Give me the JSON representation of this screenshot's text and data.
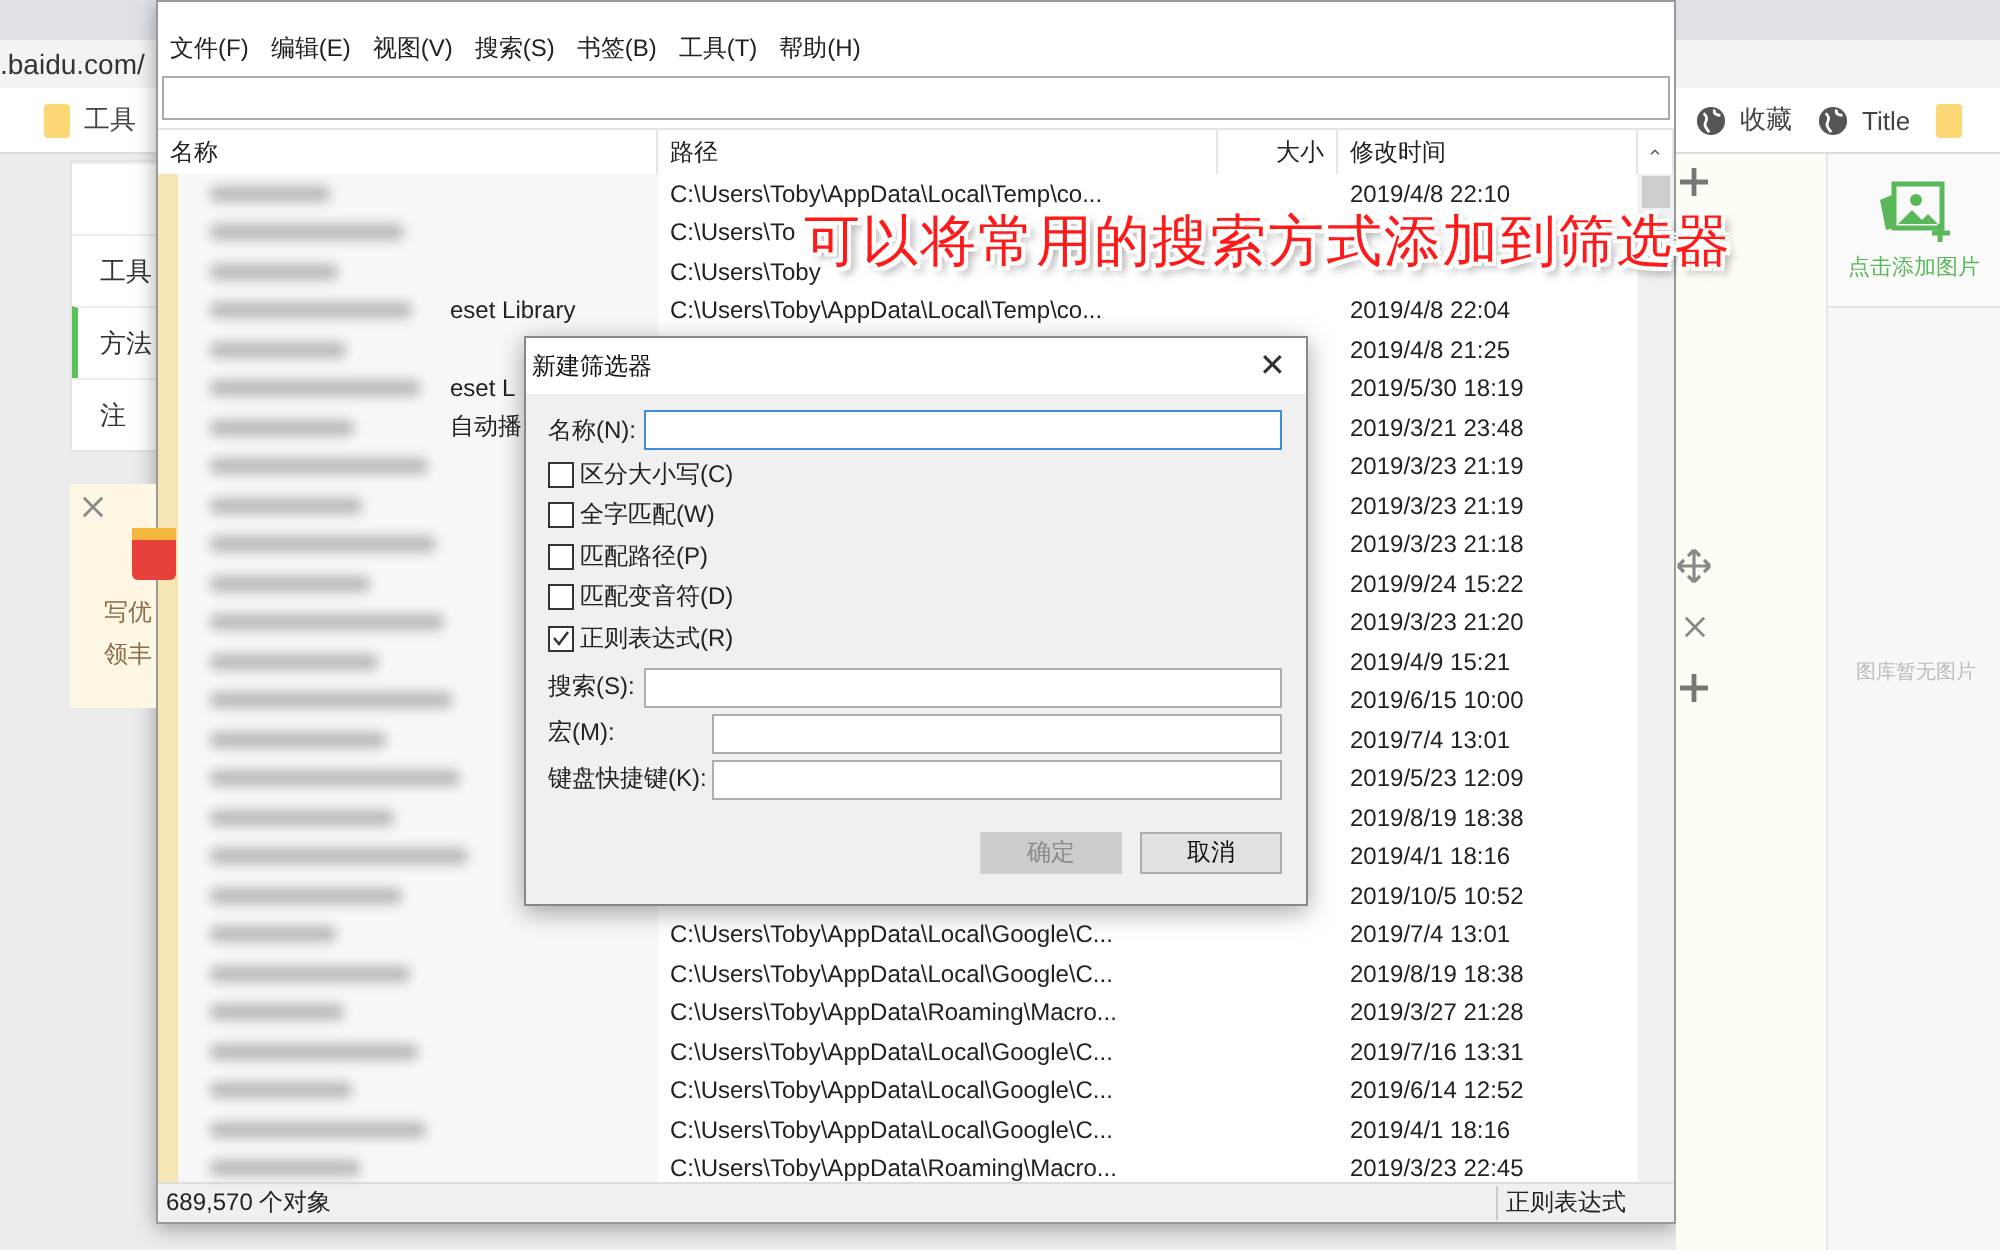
{
  "browser": {
    "url": ".baidu.com/",
    "bookmarks_left": [
      {
        "kind": "folder",
        "label": "工具"
      }
    ],
    "bookmarks_right": [
      {
        "kind": "globe",
        "label": "收藏"
      },
      {
        "kind": "globe",
        "label": "Title"
      },
      {
        "kind": "folder"
      }
    ]
  },
  "page": {
    "sidebar": {
      "items": [
        {
          "selected": false
        },
        {
          "label": "工具",
          "selected": false
        },
        {
          "label": "方法",
          "selected": true
        },
        {
          "label": "注",
          "selected": false
        }
      ]
    },
    "promo": {
      "lines": [
        "写优",
        "领丰"
      ]
    },
    "gallery": {
      "add_label": "点击添加图片",
      "empty_text": "图库暂无图片"
    }
  },
  "everything": {
    "menu": [
      "文件(F)",
      "编辑(E)",
      "视图(V)",
      "搜索(S)",
      "书签(B)",
      "工具(T)",
      "帮助(H)"
    ],
    "columns": [
      "名称",
      "路径",
      "大小",
      "修改时间"
    ],
    "rows": [
      {
        "path": "C:\\Users\\Toby\\AppData\\Local\\Temp\\co...",
        "modified": "2019/4/8 22:10"
      },
      {
        "path": "C:\\Users\\To"
      },
      {
        "path": "C:\\Users\\Toby"
      },
      {
        "name": "eset Library",
        "path": "C:\\Users\\Toby\\AppData\\Local\\Temp\\co...",
        "modified": "2019/4/8 22:04"
      },
      {
        "modified": "2019/4/8 21:25"
      },
      {
        "name": "eset L",
        "modified": "2019/5/30 18:19"
      },
      {
        "name": "自动播",
        "modified": "2019/3/21 23:48"
      },
      {
        "modified": "2019/3/23 21:19"
      },
      {
        "modified": "2019/3/23 21:19"
      },
      {
        "modified": "2019/3/23 21:18"
      },
      {
        "modified": "2019/9/24 15:22"
      },
      {
        "modified": "2019/3/23 21:20"
      },
      {
        "modified": "2019/4/9 15:21"
      },
      {
        "modified": "2019/6/15 10:00"
      },
      {
        "modified": "2019/7/4 13:01"
      },
      {
        "modified": "2019/5/23 12:09"
      },
      {
        "modified": "2019/8/19 18:38"
      },
      {
        "modified": "2019/4/1 18:16"
      },
      {
        "modified": "2019/10/5 10:52"
      },
      {
        "path": "C:\\Users\\Toby\\AppData\\Local\\Google\\C...",
        "modified": "2019/7/4 13:01"
      },
      {
        "path": "C:\\Users\\Toby\\AppData\\Local\\Google\\C...",
        "modified": "2019/8/19 18:38"
      },
      {
        "path": "C:\\Users\\Toby\\AppData\\Roaming\\Macro...",
        "modified": "2019/3/27 21:28"
      },
      {
        "path": "C:\\Users\\Toby\\AppData\\Local\\Google\\C...",
        "modified": "2019/7/16 13:31"
      },
      {
        "path": "C:\\Users\\Toby\\AppData\\Local\\Google\\C...",
        "modified": "2019/6/14 12:52"
      },
      {
        "path": "C:\\Users\\Toby\\AppData\\Local\\Google\\C...",
        "modified": "2019/4/1 18:16"
      },
      {
        "path": "C:\\Users\\Toby\\AppData\\Roaming\\Macro...",
        "modified": "2019/3/23 22:45"
      }
    ],
    "status": {
      "count": "689,570 个对象",
      "mode": "正则表达式"
    }
  },
  "dialog": {
    "title": "新建筛选器",
    "close": "✕",
    "name_label": "名称(N):",
    "options": [
      {
        "label": "区分大小写(C)",
        "checked": false
      },
      {
        "label": "全字匹配(W)",
        "checked": false
      },
      {
        "label": "匹配路径(P)",
        "checked": false
      },
      {
        "label": "匹配变音符(D)",
        "checked": false
      },
      {
        "label": "正则表达式(R)",
        "checked": true
      }
    ],
    "fields": [
      {
        "label": "搜索(S):",
        "kind": "wide"
      },
      {
        "label": "宏(M):",
        "kind": "narrow"
      },
      {
        "label": "键盘快捷键(K):",
        "kind": "narrow"
      }
    ],
    "buttons": [
      {
        "label": "确定",
        "disabled": true
      },
      {
        "label": "取消",
        "disabled": false
      }
    ]
  },
  "caption": "可以将常用的搜索方式添加到筛选器"
}
